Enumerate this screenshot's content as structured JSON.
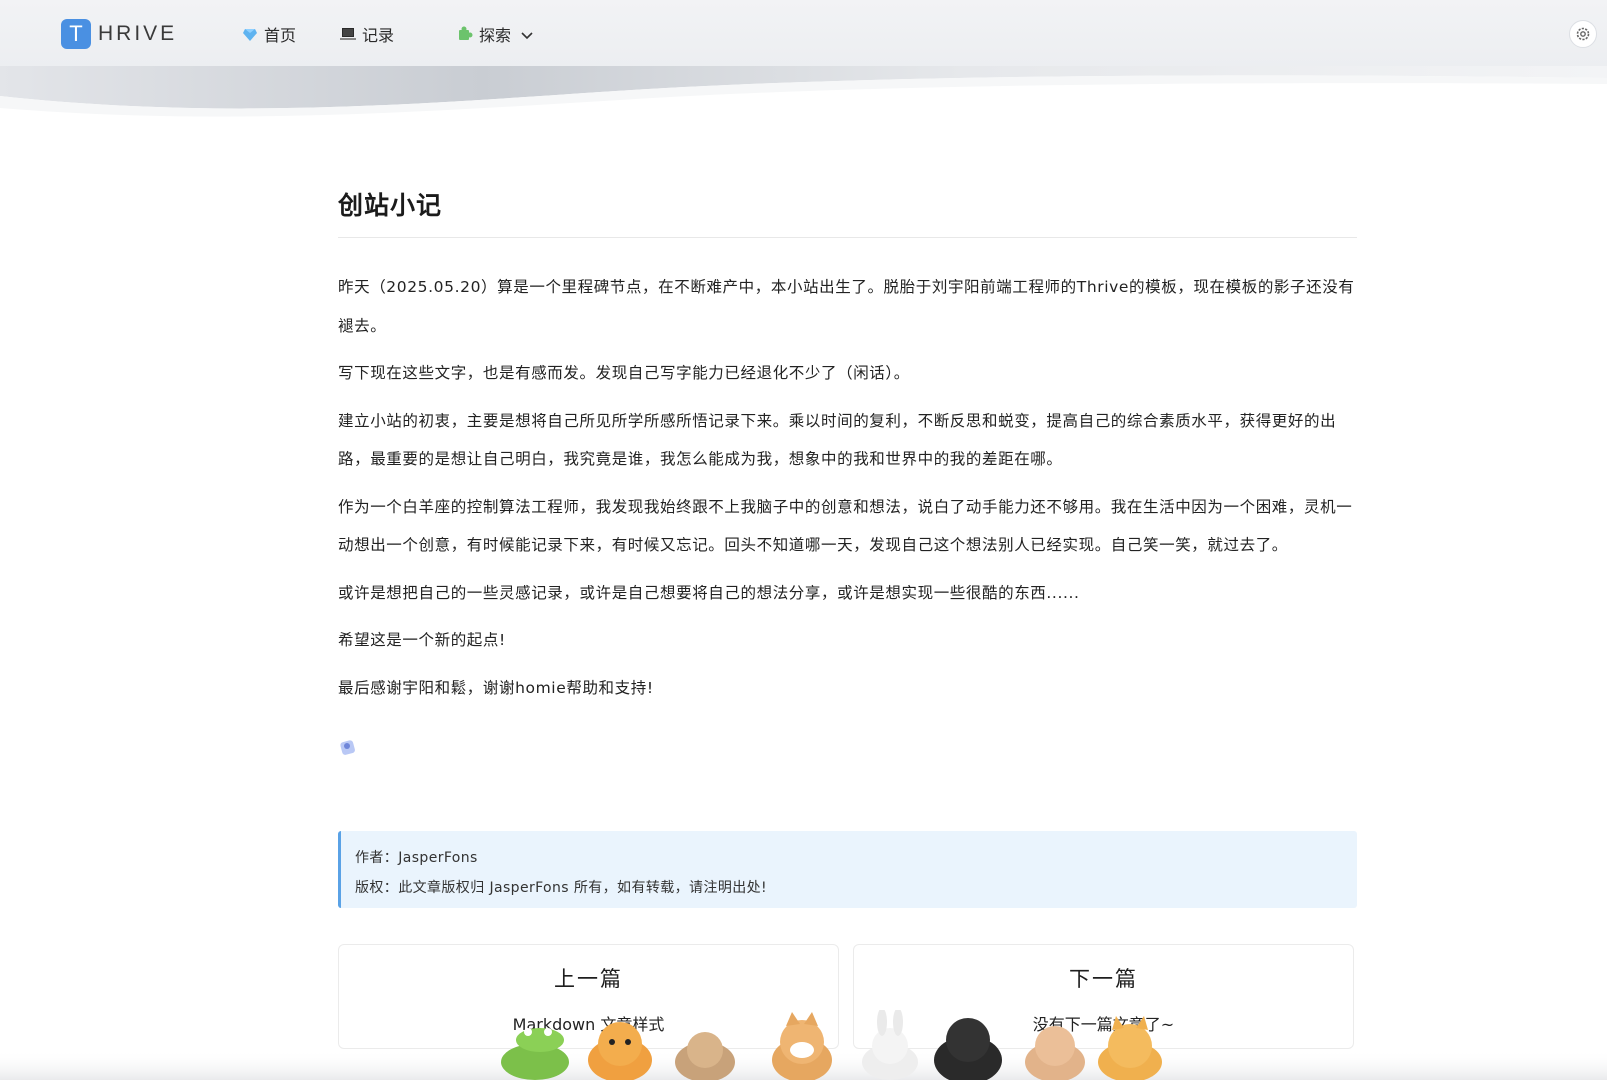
{
  "brand": {
    "logo_letter": "T",
    "name": "HRIVE"
  },
  "nav": [
    {
      "label": "首页",
      "icon": "diamond-icon"
    },
    {
      "label": "记录",
      "icon": "laptop-icon"
    },
    {
      "label": "探索",
      "icon": "puzzle-icon",
      "has_dropdown": true
    }
  ],
  "settings_icon": "gear-icon",
  "article": {
    "title": "创站小记",
    "paragraphs": [
      "昨天（2025.05.20）算是一个里程碑节点，在不断难产中，本小站出生了。脱胎于刘宇阳前端工程师的Thrive的模板，现在模板的影子还没有褪去。",
      "写下现在这些文字，也是有感而发。发现自己写字能力已经退化不少了（闲话）。",
      "建立小站的初衷，主要是想将自己所见所学所感所悟记录下来。乘以时间的复利，不断反思和蜕变，提高自己的综合素质水平，获得更好的出路，最重要的是想让自己明白，我究竟是谁，我怎么能成为我，想象中的我和世界中的我的差距在哪。",
      "作为一个白羊座的控制算法工程师，我发现我始终跟不上我脑子中的创意和想法，说白了动手能力还不够用。我在生活中因为一个困难，灵机一动想出一个创意，有时候能记录下来，有时候又忘记。回头不知道哪一天，发现自己这个想法别人已经实现。自己笑一笑，就过去了。",
      "或许是想把自己的一些灵感记录，或许是自己想要将自己的想法分享，或许是想实现一些很酷的东西......",
      "希望这是一个新的起点!",
      "最后感谢宇阳和鬆，谢谢homie帮助和支持!"
    ],
    "emoji_icon": "sticker-icon",
    "copyright": {
      "author_line": "作者：JasperFons",
      "rights_line": "版权：此文章版权归 JasperFons 所有，如有转载，请注明出处!"
    }
  },
  "pager": {
    "prev": {
      "heading": "上一篇",
      "title": "Markdown 文章样式"
    },
    "next": {
      "heading": "下一篇",
      "title": "没有下一篇文章了~"
    }
  },
  "colors": {
    "accent": "#4a90e2",
    "quote_bg": "#eaf4fd",
    "quote_border": "#5aa2e6"
  }
}
